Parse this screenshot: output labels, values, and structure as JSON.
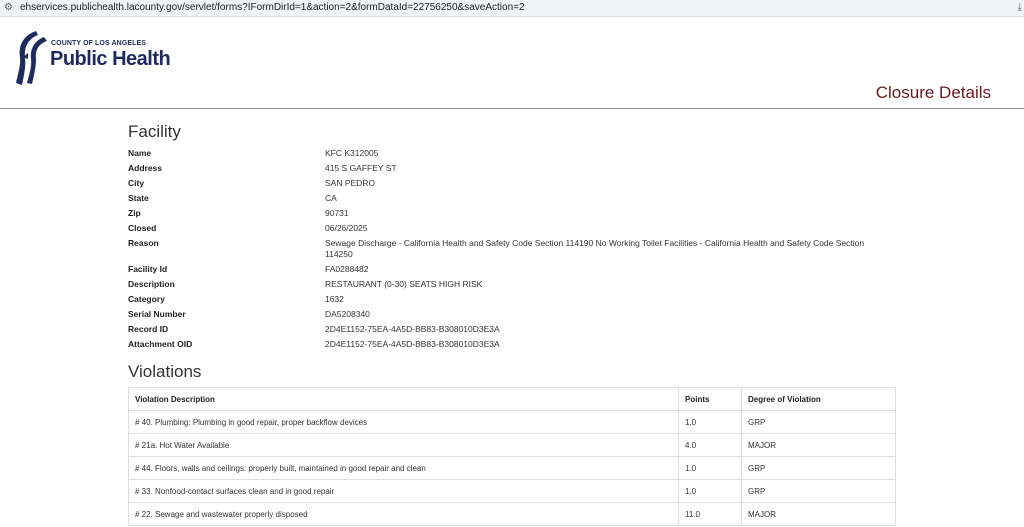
{
  "browser": {
    "url": "ehservices.publichealth.lacounty.gov/servlet/forms?IFormDirId=1&action=2&formDataId=22756250&saveAction=2"
  },
  "header": {
    "logo_county": "COUNTY OF LOS ANGELES",
    "logo_name": "Public Health",
    "page_title": "Closure Details"
  },
  "facility": {
    "title": "Facility",
    "fields": [
      {
        "label": "Name",
        "value": "KFC K312005"
      },
      {
        "label": "Address",
        "value": "415 S GAFFEY ST"
      },
      {
        "label": "City",
        "value": "SAN PEDRO"
      },
      {
        "label": "State",
        "value": "CA"
      },
      {
        "label": "Zip",
        "value": "90731"
      },
      {
        "label": "Closed",
        "value": "06/26/2025"
      },
      {
        "label": "Reason",
        "value": "Sewage Discharge - California Health and Safety Code Section 114190 No Working Toilet Facilities - California Health and Safety Code Section 114250"
      },
      {
        "label": "Facility Id",
        "value": "FA0288482"
      },
      {
        "label": "Description",
        "value": "RESTAURANT (0-30) SEATS HIGH RISK"
      },
      {
        "label": "Category",
        "value": "1632"
      },
      {
        "label": "Serial Number",
        "value": "DA5208340"
      },
      {
        "label": "Record ID",
        "value": "2D4E1152-75EA-4A5D-BB83-B308010D3E3A"
      },
      {
        "label": "Attachment OID",
        "value": "2D4E1152-75EA-4A5D-BB83-B308010D3E3A"
      }
    ]
  },
  "violations": {
    "title": "Violations",
    "headers": [
      "Violation Description",
      "Points",
      "Degree of Violation"
    ],
    "rows": [
      [
        "# 40. Plumbing: Plumbing in good repair, proper backflow devices",
        "1.0",
        "GRP"
      ],
      [
        "# 21a. Hot Water Available",
        "4.0",
        "MAJOR"
      ],
      [
        "# 44. Floors, walls and ceilings: properly built, maintained in good repair and clean",
        "1.0",
        "GRP"
      ],
      [
        "# 33. Nonfood-contact surfaces clean and in good repair",
        "1.0",
        "GRP"
      ],
      [
        "# 22. Sewage and wastewater properly disposed",
        "11.0",
        "MAJOR"
      ]
    ]
  },
  "colors": {
    "title_maroon": "#6b1a1f",
    "logo_navy": "#1e2b5e"
  },
  "icons": [
    "site-settings-icon",
    "logo-faces-icon"
  ]
}
